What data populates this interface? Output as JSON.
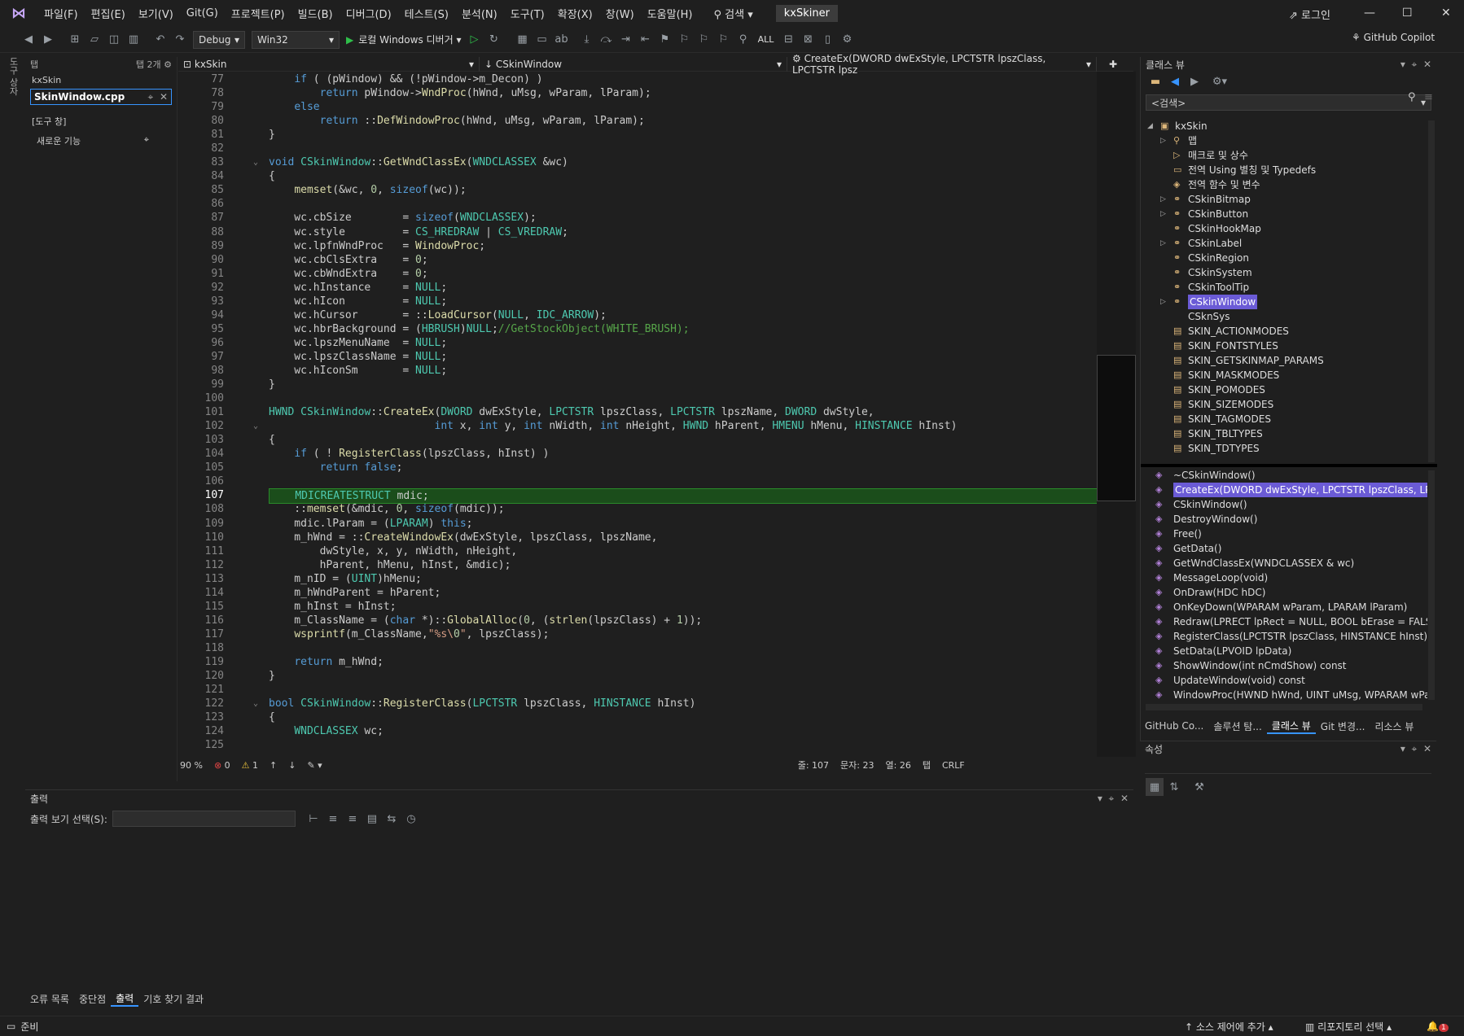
{
  "menu": {
    "items": [
      "파일(F)",
      "편집(E)",
      "보기(V)",
      "Git(G)",
      "프로젝트(P)",
      "빌드(B)",
      "디버그(D)",
      "테스트(S)",
      "분석(N)",
      "도구(T)",
      "확장(X)",
      "창(W)",
      "도움말(H)"
    ],
    "search": "검색",
    "solution": "kxSkiner",
    "login": "로그인"
  },
  "toolbar": {
    "config": "Debug",
    "platform": "Win32",
    "run": "로컬 Windows 디버거",
    "all": "ALL",
    "copilot": "GitHub Copilot"
  },
  "toolbox": {
    "tab_label": "탭",
    "count": "탭 2개",
    "group": "kxSkin",
    "active_file": "SkinWindow.cpp",
    "tool_group": "[도구 창]",
    "new_feature": "새로운 기능",
    "side_tab": "도구 상자"
  },
  "editor": {
    "nav_project": "kxSkin",
    "nav_class": "CSkinWindow",
    "nav_member": "CreateEx(DWORD dwExStyle, LPCTSTR lpszClass, LPCTSTR lpsz",
    "lines": [
      {
        "n": "77",
        "t": "    if ( (pWindow) && (!pWindow->m_Decon) )",
        "fold": ""
      },
      {
        "n": "78",
        "t": "        return pWindow->WndProc(hWnd, uMsg, wParam, lParam);",
        "fold": ""
      },
      {
        "n": "79",
        "t": "    else",
        "fold": ""
      },
      {
        "n": "80",
        "t": "        return ::DefWindowProc(hWnd, uMsg, wParam, lParam);",
        "fold": ""
      },
      {
        "n": "81",
        "t": "}",
        "fold": ""
      },
      {
        "n": "82",
        "t": "",
        "fold": ""
      },
      {
        "n": "83",
        "t": "void CSkinWindow::GetWndClassEx(WNDCLASSEX &wc)",
        "fold": "⌄"
      },
      {
        "n": "84",
        "t": "{",
        "fold": ""
      },
      {
        "n": "85",
        "t": "    memset(&wc, 0, sizeof(wc));",
        "fold": ""
      },
      {
        "n": "86",
        "t": "",
        "fold": ""
      },
      {
        "n": "87",
        "t": "    wc.cbSize        = sizeof(WNDCLASSEX);",
        "fold": ""
      },
      {
        "n": "88",
        "t": "    wc.style         = CS_HREDRAW | CS_VREDRAW;",
        "fold": ""
      },
      {
        "n": "89",
        "t": "    wc.lpfnWndProc   = WindowProc;",
        "fold": ""
      },
      {
        "n": "90",
        "t": "    wc.cbClsExtra    = 0;",
        "fold": ""
      },
      {
        "n": "91",
        "t": "    wc.cbWndExtra    = 0;",
        "fold": ""
      },
      {
        "n": "92",
        "t": "    wc.hInstance     = NULL;",
        "fold": ""
      },
      {
        "n": "93",
        "t": "    wc.hIcon         = NULL;",
        "fold": ""
      },
      {
        "n": "94",
        "t": "    wc.hCursor       = ::LoadCursor(NULL, IDC_ARROW);",
        "fold": ""
      },
      {
        "n": "95",
        "t": "    wc.hbrBackground = (HBRUSH)NULL;//GetStockObject(WHITE_BRUSH);",
        "fold": ""
      },
      {
        "n": "96",
        "t": "    wc.lpszMenuName  = NULL;",
        "fold": ""
      },
      {
        "n": "97",
        "t": "    wc.lpszClassName = NULL;",
        "fold": ""
      },
      {
        "n": "98",
        "t": "    wc.hIconSm       = NULL;",
        "fold": ""
      },
      {
        "n": "99",
        "t": "}",
        "fold": ""
      },
      {
        "n": "100",
        "t": "",
        "fold": ""
      },
      {
        "n": "101",
        "t": "HWND CSkinWindow::CreateEx(DWORD dwExStyle, LPCTSTR lpszClass, LPCTSTR lpszName, DWORD dwStyle,",
        "fold": ""
      },
      {
        "n": "102",
        "t": "                          int x, int y, int nWidth, int nHeight, HWND hParent, HMENU hMenu, HINSTANCE hInst)",
        "fold": "⌄"
      },
      {
        "n": "103",
        "t": "{",
        "fold": ""
      },
      {
        "n": "104",
        "t": "    if ( ! RegisterClass(lpszClass, hInst) )",
        "fold": ""
      },
      {
        "n": "105",
        "t": "        return false;",
        "fold": ""
      },
      {
        "n": "106",
        "t": "",
        "fold": ""
      },
      {
        "n": "107",
        "t": "    MDICREATESTRUCT mdic;",
        "fold": ""
      },
      {
        "n": "108",
        "t": "    ::memset(&mdic, 0, sizeof(mdic));",
        "fold": ""
      },
      {
        "n": "109",
        "t": "    mdic.lParam = (LPARAM) this;",
        "fold": ""
      },
      {
        "n": "110",
        "t": "    m_hWnd = ::CreateWindowEx(dwExStyle, lpszClass, lpszName,",
        "fold": ""
      },
      {
        "n": "111",
        "t": "        dwStyle, x, y, nWidth, nHeight,",
        "fold": ""
      },
      {
        "n": "112",
        "t": "        hParent, hMenu, hInst, &mdic);",
        "fold": ""
      },
      {
        "n": "113",
        "t": "    m_nID = (UINT)hMenu;",
        "fold": ""
      },
      {
        "n": "114",
        "t": "    m_hWndParent = hParent;",
        "fold": ""
      },
      {
        "n": "115",
        "t": "    m_hInst = hInst;",
        "fold": ""
      },
      {
        "n": "116",
        "t": "    m_ClassName = (char *)::GlobalAlloc(0, (strlen(lpszClass) + 1));",
        "fold": ""
      },
      {
        "n": "117",
        "t": "    wsprintf(m_ClassName,\"%s\\0\", lpszClass);",
        "fold": ""
      },
      {
        "n": "118",
        "t": "",
        "fold": ""
      },
      {
        "n": "119",
        "t": "    return m_hWnd;",
        "fold": ""
      },
      {
        "n": "120",
        "t": "}",
        "fold": ""
      },
      {
        "n": "121",
        "t": "",
        "fold": ""
      },
      {
        "n": "122",
        "t": "bool CSkinWindow::RegisterClass(LPCTSTR lpszClass, HINSTANCE hInst)",
        "fold": "⌄"
      },
      {
        "n": "123",
        "t": "{",
        "fold": ""
      },
      {
        "n": "124",
        "t": "    WNDCLASSEX wc;",
        "fold": ""
      },
      {
        "n": "125",
        "t": "",
        "fold": ""
      }
    ],
    "current_line": "107",
    "status": {
      "zoom": "90 %",
      "errors": "0",
      "warnings": "1",
      "line": "줄: 107",
      "col": "문자: 23",
      "chars": "열: 26",
      "tab": "탭",
      "eol": "CRLF"
    }
  },
  "output": {
    "title": "출력",
    "select_label": "출력 보기 선택(S):"
  },
  "bottom_tabs": [
    "오류 목록",
    "중단점",
    "출력",
    "기호 찾기 결과"
  ],
  "classview": {
    "title": "클래스 뷰",
    "search": "<검색>",
    "tree": [
      {
        "label": "kxSkin",
        "indent": 0,
        "exp": "◢",
        "icon": "▣"
      },
      {
        "label": "맵",
        "indent": 1,
        "exp": "▷",
        "icon": "⚲"
      },
      {
        "label": "매크로 및 상수",
        "indent": 1,
        "exp": "",
        "icon": "▷"
      },
      {
        "label": "전역 Using 별칭 및 Typedefs",
        "indent": 1,
        "exp": "",
        "icon": "▭"
      },
      {
        "label": "전역 함수 및 변수",
        "indent": 1,
        "exp": "",
        "icon": "◈"
      },
      {
        "label": "CSkinBitmap",
        "indent": 1,
        "exp": "▷",
        "icon": "⚭"
      },
      {
        "label": "CSkinButton",
        "indent": 1,
        "exp": "▷",
        "icon": "⚭"
      },
      {
        "label": "CSkinHookMap",
        "indent": 1,
        "exp": "",
        "icon": "⚭"
      },
      {
        "label": "CSkinLabel",
        "indent": 1,
        "exp": "▷",
        "icon": "⚭"
      },
      {
        "label": "CSkinRegion",
        "indent": 1,
        "exp": "",
        "icon": "⚭"
      },
      {
        "label": "CSkinSystem",
        "indent": 1,
        "exp": "",
        "icon": "⚭"
      },
      {
        "label": "CSkinToolTip",
        "indent": 1,
        "exp": "",
        "icon": "⚭"
      },
      {
        "label": "CSkinWindow",
        "indent": 1,
        "exp": "▷",
        "icon": "⚭",
        "sel": true
      },
      {
        "label": "CSknSys",
        "indent": 1,
        "exp": "",
        "icon": ""
      },
      {
        "label": "SKIN_ACTIONMODES",
        "indent": 1,
        "exp": "",
        "icon": "▤"
      },
      {
        "label": "SKIN_FONTSTYLES",
        "indent": 1,
        "exp": "",
        "icon": "▤"
      },
      {
        "label": "SKIN_GETSKINMAP_PARAMS",
        "indent": 1,
        "exp": "",
        "icon": "▤"
      },
      {
        "label": "SKIN_MASKMODES",
        "indent": 1,
        "exp": "",
        "icon": "▤"
      },
      {
        "label": "SKIN_POMODES",
        "indent": 1,
        "exp": "",
        "icon": "▤"
      },
      {
        "label": "SKIN_SIZEMODES",
        "indent": 1,
        "exp": "",
        "icon": "▤"
      },
      {
        "label": "SKIN_TAGMODES",
        "indent": 1,
        "exp": "",
        "icon": "▤"
      },
      {
        "label": "SKIN_TBLTYPES",
        "indent": 1,
        "exp": "",
        "icon": "▤"
      },
      {
        "label": "SKIN_TDTYPES",
        "indent": 1,
        "exp": "",
        "icon": "▤"
      }
    ],
    "members": [
      {
        "label": "~CSkinWindow()"
      },
      {
        "label": "CreateEx(DWORD dwExStyle, LPCTSTR lpszClass, LPCTST",
        "sel": true
      },
      {
        "label": "CSkinWindow()"
      },
      {
        "label": "DestroyWindow()"
      },
      {
        "label": "Free()"
      },
      {
        "label": "GetData()"
      },
      {
        "label": "GetWndClassEx(WNDCLASSEX & wc)"
      },
      {
        "label": "MessageLoop(void)"
      },
      {
        "label": "OnDraw(HDC hDC)"
      },
      {
        "label": "OnKeyDown(WPARAM wParam, LPARAM lParam)"
      },
      {
        "label": "Redraw(LPRECT lpRect = NULL, BOOL bErase = FALSE)"
      },
      {
        "label": "RegisterClass(LPCTSTR lpszClass, HINSTANCE hInst)"
      },
      {
        "label": "SetData(LPVOID lpData)"
      },
      {
        "label": "ShowWindow(int nCmdShow) const"
      },
      {
        "label": "UpdateWindow(void) const"
      },
      {
        "label": "WindowProc(HWND hWnd, UINT uMsg, WPARAM wPara"
      }
    ],
    "tabs": [
      "GitHub Co...",
      "솔루션 탐...",
      "클래스 뷰",
      "Git 변경...",
      "리소스 뷰"
    ],
    "props_title": "속성"
  },
  "status": {
    "ready": "준비",
    "source_control": "소스 제어에 추가",
    "repo": "리포지토리 선택",
    "notif": "1"
  }
}
